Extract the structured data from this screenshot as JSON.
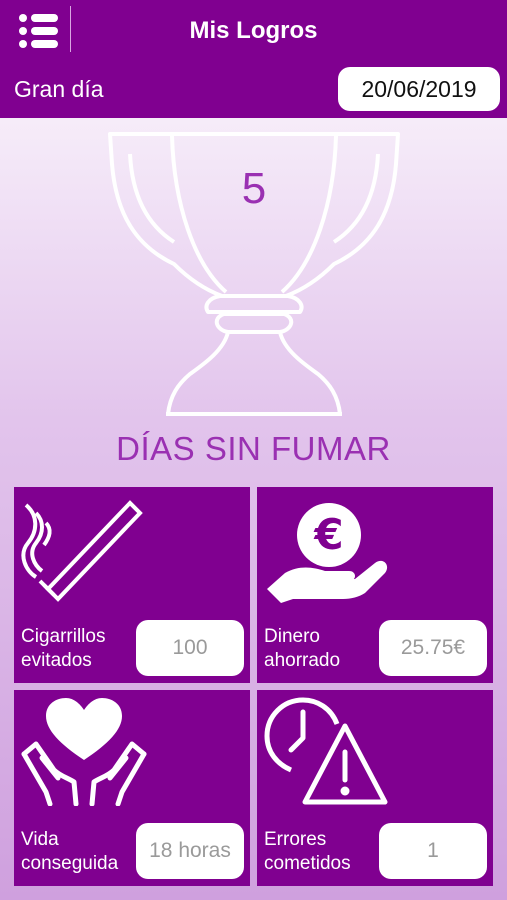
{
  "header": {
    "title": "Mis Logros",
    "menu_icon": "list-menu-icon"
  },
  "date_bar": {
    "label": "Gran día",
    "date": "20/06/2019"
  },
  "trophy": {
    "days": "5",
    "caption": "DÍAS SIN FUMAR",
    "icon": "trophy-icon"
  },
  "stats": [
    {
      "label_line1": "Cigarrillos",
      "label_line2": "evitados",
      "value": "100",
      "icon": "cigarette-icon"
    },
    {
      "label_line1": "Dinero",
      "label_line2": "ahorrado",
      "value": "25.75€",
      "icon": "euro-coin-hand-icon"
    },
    {
      "label_line1": "Vida",
      "label_line2": "conseguida",
      "value": "18 horas",
      "icon": "heart-hands-icon"
    },
    {
      "label_line1": "Errores",
      "label_line2": "cometidos",
      "value": "1",
      "icon": "clock-warning-icon"
    }
  ],
  "colors": {
    "primary": "#800090",
    "accent_text": "#9a30b2",
    "value_text": "#9a9a9a"
  }
}
